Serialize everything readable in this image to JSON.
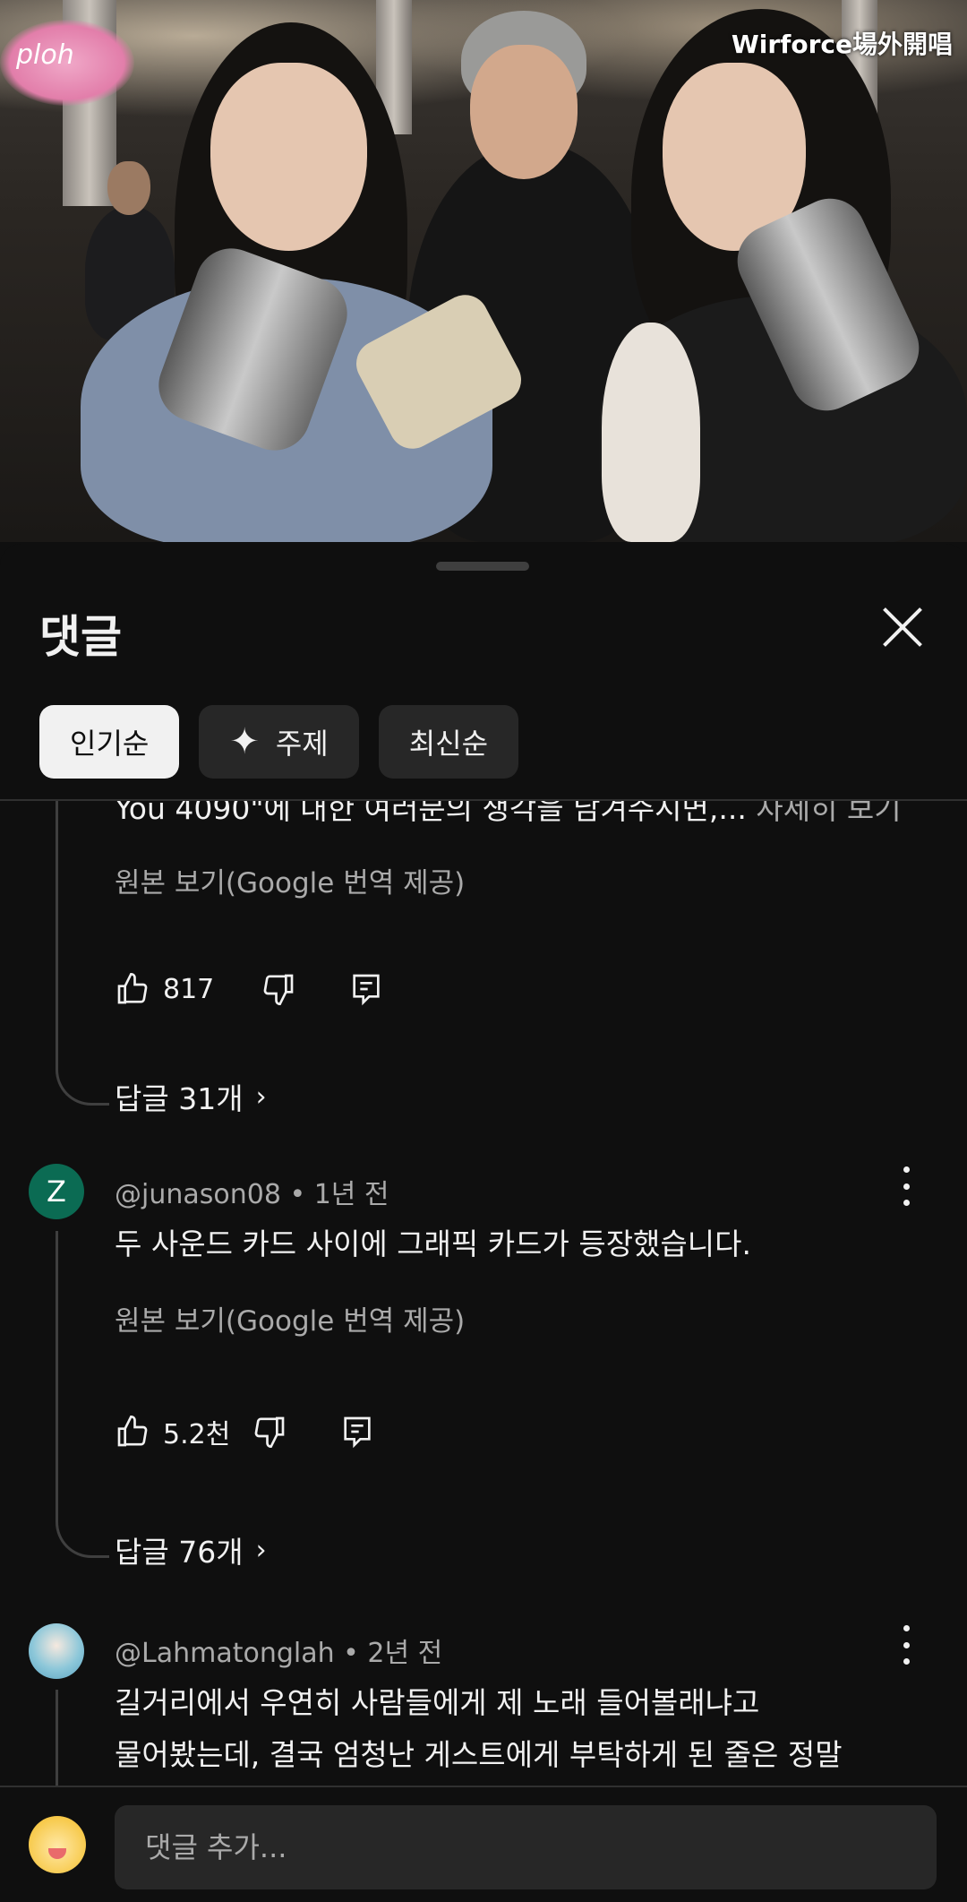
{
  "video": {
    "watermark": "Wirforce場外開唱",
    "logo_text": "ploh"
  },
  "panel": {
    "title": "댓글",
    "close_icon": "close-icon"
  },
  "sort_chips": [
    {
      "label": "인기순",
      "selected": true
    },
    {
      "label": "주제",
      "icon": "sparkle-icon",
      "selected": false
    },
    {
      "label": "최신순",
      "selected": false
    }
  ],
  "comments": [
    {
      "partial_text": "You 4090\"에 대한 여러분의 생각을 남겨주시면,...",
      "more_label": " 자세히 보기",
      "translate_label": "원본 보기(Google 번역 제공)",
      "likes": "817",
      "replies_label": "답글 31개"
    },
    {
      "avatar_letter": "Z",
      "author": "@junason08",
      "time": "1년 전",
      "text": "두 사운드 카드 사이에 그래픽 카드가 등장했습니다.",
      "translate_label": "원본 보기(Google 번역 제공)",
      "likes": "5.2천",
      "replies_label": "답글 76개"
    },
    {
      "author": "@Lahmatonglah",
      "time": "2년 전",
      "text_line1": "길거리에서 우연히 사람들에게 제 노래 들어볼래냐고",
      "text_line2": "물어봤는데, 결국 엄청난 게스트에게 부탁하게 된 줄은 정말"
    }
  ],
  "input": {
    "placeholder": "댓글 추가..."
  },
  "colors": {
    "background": "#0f0f0f",
    "chip_bg": "#272727",
    "chip_active_bg": "#f1f1f1",
    "secondary_text": "#aaaaaa",
    "avatar_z": "#0b6b53"
  }
}
